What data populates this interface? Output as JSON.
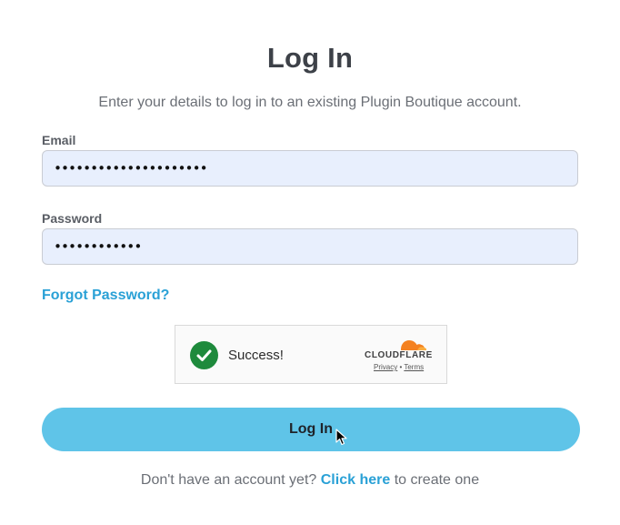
{
  "title": "Log In",
  "subtitle": "Enter your details to log in to an existing Plugin Boutique account.",
  "email": {
    "label": "Email",
    "value": "•••••••••••••••••••••"
  },
  "password": {
    "label": "Password",
    "value": "••••••••••••"
  },
  "forgot_password": "Forgot Password?",
  "captcha": {
    "status": "Success!",
    "brand": "CLOUDFLARE",
    "privacy": "Privacy",
    "separator": "•",
    "terms": "Terms"
  },
  "login_button": "Log In",
  "signup": {
    "prefix": "Don't have an account yet?",
    "link": "Click here",
    "suffix": "to create one"
  },
  "colors": {
    "accent": "#2aa1d6",
    "button": "#5fc4e8",
    "input_bg": "#e8effd",
    "success": "#1e8a3c",
    "cloudflare_orange": "#f48120"
  }
}
